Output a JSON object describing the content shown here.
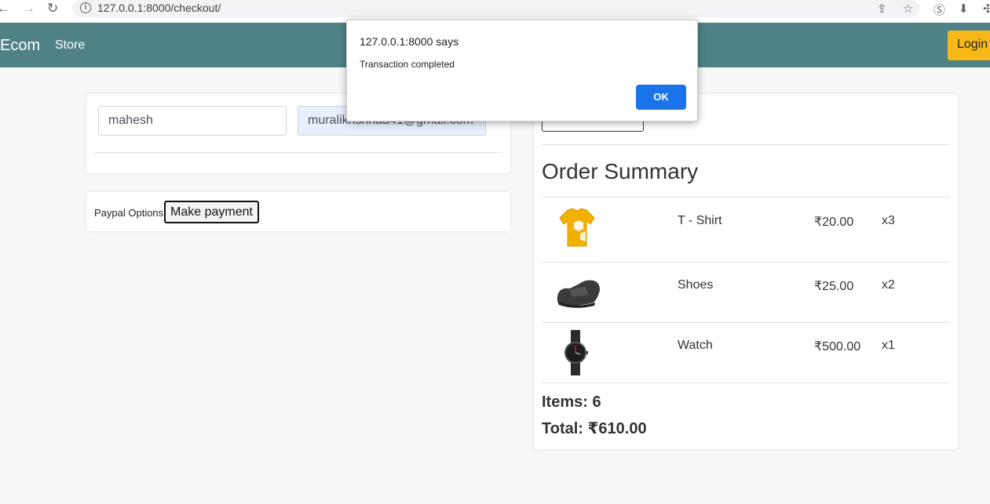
{
  "browser": {
    "url": "127.0.0.1:8000/checkout/",
    "info_glyph": "i"
  },
  "navbar": {
    "brand": "Ecom",
    "store_link": "Store",
    "login_label": "Login",
    "background": "#4f8287",
    "login_color": "#f6b918"
  },
  "form": {
    "name_value": "mahesh",
    "email_value": "muralikrishnaa41@gmail.com"
  },
  "payment": {
    "label": "Paypal Options",
    "button_label": "Make payment"
  },
  "summary": {
    "title": "Order Summary",
    "items": [
      {
        "name": "T - Shirt",
        "price": "₹20.00",
        "qty": "x3",
        "icon": "tshirt-icon"
      },
      {
        "name": "Shoes",
        "price": "₹25.00",
        "qty": "x2",
        "icon": "shoe-icon"
      },
      {
        "name": "Watch",
        "price": "₹500.00",
        "qty": "x1",
        "icon": "watch-icon"
      }
    ],
    "items_label": "Items: 6",
    "total_label": "Total: ₹610.00"
  },
  "alert": {
    "title": "127.0.0.1:8000 says",
    "message": "Transaction completed",
    "ok_label": "OK",
    "ok_color": "#1a73e8"
  }
}
